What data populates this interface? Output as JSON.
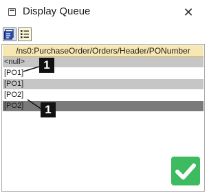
{
  "window": {
    "title": "Display Queue",
    "close_glyph": "✕"
  },
  "toolbar": {
    "buttons": [
      {
        "icon": "context-queue-icon"
      },
      {
        "icon": "list-view-icon"
      }
    ]
  },
  "queue": {
    "column_header": "/ns0:PurchaseOrder/Orders/Header/PONumber",
    "rows": [
      {
        "value": "<null>"
      },
      {
        "value": "[PO1]"
      },
      {
        "value": "[PO1]"
      },
      {
        "value": "[PO2]"
      },
      {
        "value": "[PO2]"
      }
    ]
  },
  "callouts": [
    {
      "label": "1"
    },
    {
      "label": "1"
    }
  ],
  "colors": {
    "header_bg": "#f7e7b2",
    "row_gray": "#c6c6c6",
    "row_dark": "#7a7a7a",
    "ok_green": "#3dbb60"
  }
}
